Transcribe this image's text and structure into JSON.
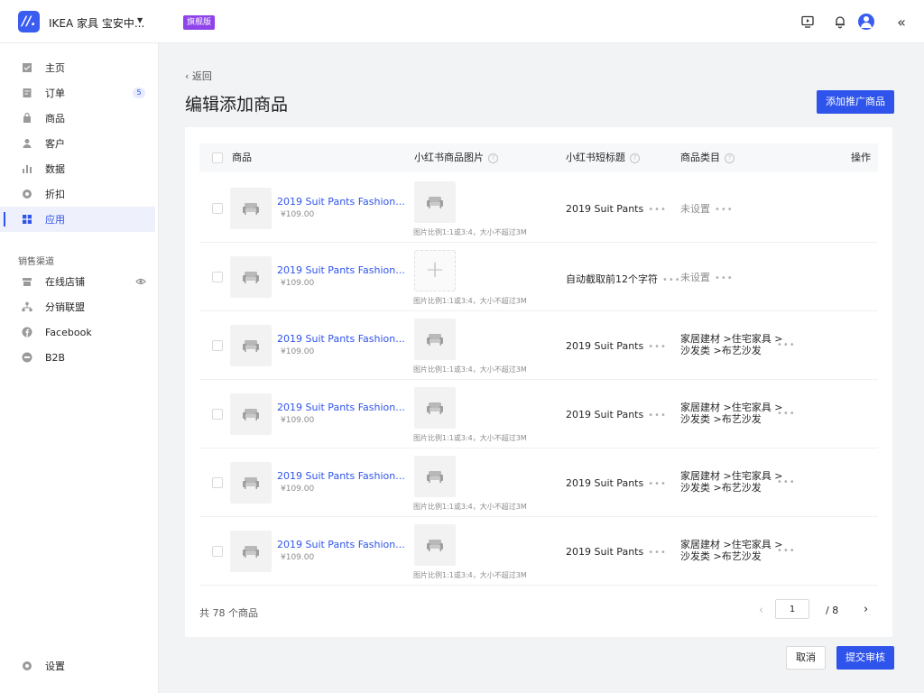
{
  "topbar": {
    "logo_text": "//.",
    "store_name": "IKEA 家具 宝安中...",
    "edition_badge": "旗舰版",
    "icons": [
      "monitor-play-icon",
      "bell-icon",
      "user-avatar",
      "collapse-icon"
    ],
    "collapse_glyph": "«"
  },
  "sidebar": {
    "items": [
      {
        "label": "主页",
        "icon": "home-icon"
      },
      {
        "label": "订单",
        "icon": "orders-icon",
        "badge": "5"
      },
      {
        "label": "商品",
        "icon": "product-icon"
      },
      {
        "label": "客户",
        "icon": "customer-icon"
      },
      {
        "label": "数据",
        "icon": "data-chart-icon"
      },
      {
        "label": "折扣",
        "icon": "discount-icon"
      },
      {
        "label": "应用",
        "icon": "apps-icon",
        "active": true
      }
    ],
    "section_title": "销售渠道",
    "channels": [
      {
        "label": "在线店铺",
        "icon": "store-icon"
      },
      {
        "label": "分销联盟",
        "icon": "distribution-icon"
      },
      {
        "label": "Facebook",
        "icon": "facebook-icon"
      },
      {
        "label": "B2B",
        "icon": "b2b-icon"
      }
    ],
    "settings_label": "设置"
  },
  "page": {
    "back_label": "返回",
    "title": "编辑添加商品",
    "add_button": "添加推广商品"
  },
  "table": {
    "columns": {
      "product": "商品",
      "image": "小红书商品图片",
      "short_title": "小红书短标题",
      "category": "商品类目",
      "actions": "操作"
    },
    "image_hint": "图片比例1:1或3:4，大小不超过3M",
    "rows": [
      {
        "name": "2019 Suit Pants Fashion...",
        "price": "¥109.00",
        "has_image": true,
        "short_title": "2019 Suit Pants",
        "category_line1": "未设置",
        "category_line2": ""
      },
      {
        "name": "2019 Suit Pants Fashion...",
        "price": "¥109.00",
        "has_image": false,
        "short_title": "自动截取前12个字符",
        "category_line1": "未设置",
        "category_line2": ""
      },
      {
        "name": "2019 Suit Pants Fashion...",
        "price": "¥109.00",
        "has_image": true,
        "short_title": "2019 Suit Pants",
        "category_line1": "家居建材 >住宅家具 >",
        "category_line2": "沙发类 >布艺沙发"
      },
      {
        "name": "2019 Suit Pants Fashion...",
        "price": "¥109.00",
        "has_image": true,
        "short_title": "2019 Suit Pants",
        "category_line1": "家居建材 >住宅家具 >",
        "category_line2": "沙发类 >布艺沙发"
      },
      {
        "name": "2019 Suit Pants Fashion...",
        "price": "¥109.00",
        "has_image": true,
        "short_title": "2019 Suit Pants",
        "category_line1": "家居建材 >住宅家具 >",
        "category_line2": "沙发类 >布艺沙发"
      },
      {
        "name": "2019 Suit Pants Fashion...",
        "price": "¥109.00",
        "has_image": true,
        "short_title": "2019 Suit Pants",
        "category_line1": "家居建材 >住宅家具 >",
        "category_line2": "沙发类 >布艺沙发"
      }
    ],
    "more_glyph": "•••"
  },
  "pagination": {
    "total_text": "共 78 个商品",
    "current_page": "1",
    "total_pages": "/ 8",
    "prev_glyph": "‹",
    "next_glyph": "›"
  },
  "footer": {
    "cancel": "取消",
    "submit": "提交审核"
  },
  "colors": {
    "primary": "#2f54eb",
    "flagship_badge": "#8e44e8",
    "logo_bg": "#3a5cf0"
  }
}
